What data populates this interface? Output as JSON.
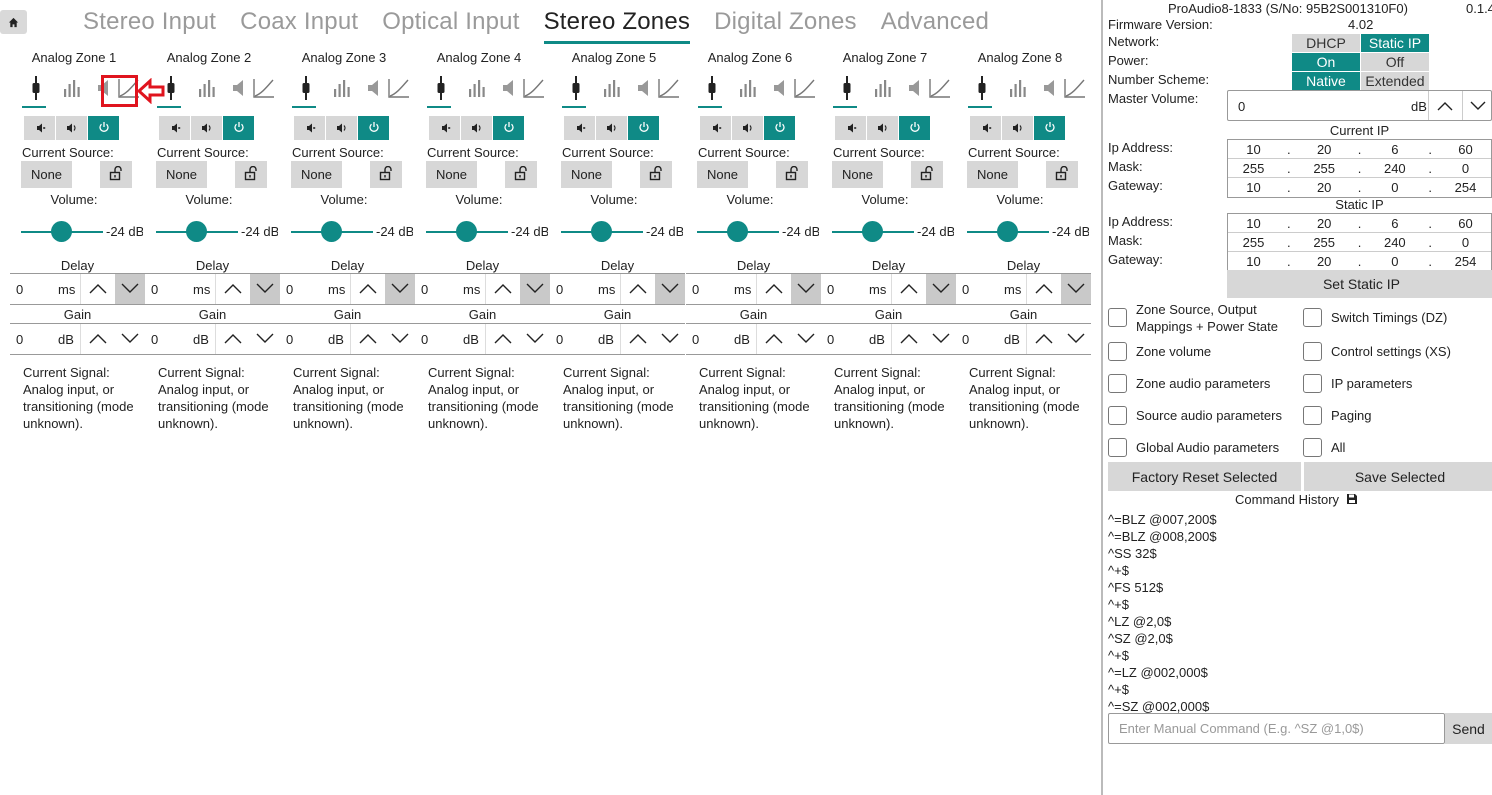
{
  "tabs": [
    "Stereo Input",
    "Coax Input",
    "Optical Input",
    "Stereo Zones",
    "Digital Zones",
    "Advanced"
  ],
  "active_tab": "Stereo Zones",
  "zone_labels": {
    "current_source": "Current Source:",
    "volume": "Volume:",
    "delay": "Delay",
    "gain": "Gain"
  },
  "zones": [
    {
      "name": "Analog Zone 1",
      "source": "None",
      "volume": "-24 dB",
      "volume_level_db": -24,
      "delay": "0",
      "delay_unit": "ms",
      "gain": "0",
      "gain_unit": "dB",
      "signal": "Current Signal: Analog input, or transitioning (mode unknown)."
    },
    {
      "name": "Analog Zone 2",
      "source": "None",
      "volume": "-24 dB",
      "volume_level_db": -24,
      "delay": "0",
      "delay_unit": "ms",
      "gain": "0",
      "gain_unit": "dB",
      "signal": "Current Signal: Analog input, or transitioning (mode unknown)."
    },
    {
      "name": "Analog Zone 3",
      "source": "None",
      "volume": "-24 dB",
      "volume_level_db": -24,
      "delay": "0",
      "delay_unit": "ms",
      "gain": "0",
      "gain_unit": "dB",
      "signal": "Current Signal: Analog input, or transitioning (mode unknown)."
    },
    {
      "name": "Analog Zone 4",
      "source": "None",
      "volume": "-24 dB",
      "volume_level_db": -24,
      "delay": "0",
      "delay_unit": "ms",
      "gain": "0",
      "gain_unit": "dB",
      "signal": "Current Signal: Analog input, or transitioning (mode unknown)."
    },
    {
      "name": "Analog Zone 5",
      "source": "None",
      "volume": "-24 dB",
      "volume_level_db": -24,
      "delay": "0",
      "delay_unit": "ms",
      "gain": "0",
      "gain_unit": "dB",
      "signal": "Current Signal: Analog input, or transitioning (mode unknown)."
    },
    {
      "name": "Analog Zone 6",
      "source": "None",
      "volume": "-24 dB",
      "volume_level_db": -24,
      "delay": "0",
      "delay_unit": "ms",
      "gain": "0",
      "gain_unit": "dB",
      "signal": "Current Signal: Analog input, or transitioning (mode unknown)."
    },
    {
      "name": "Analog Zone 7",
      "source": "None",
      "volume": "-24 dB",
      "volume_level_db": -24,
      "delay": "0",
      "delay_unit": "ms",
      "gain": "0",
      "gain_unit": "dB",
      "signal": "Current Signal: Analog input, or transitioning (mode unknown)."
    },
    {
      "name": "Analog Zone 8",
      "source": "None",
      "volume": "-24 dB",
      "volume_level_db": -24,
      "delay": "0",
      "delay_unit": "ms",
      "gain": "0",
      "gain_unit": "dB",
      "signal": "Current Signal: Analog input, or transitioning (mode unknown)."
    }
  ],
  "device": {
    "title": "ProAudio8-1833 (S/No: 95B2S001310F0)",
    "version": "0.1.4",
    "firmware_label": "Firmware Version:",
    "firmware": "4.02"
  },
  "settings": {
    "network_label": "Network:",
    "network_options": [
      "DHCP",
      "Static IP"
    ],
    "network_selected": "Static IP",
    "power_label": "Power:",
    "power_options": [
      "On",
      "Off"
    ],
    "power_selected": "On",
    "scheme_label": "Number Scheme:",
    "scheme_options": [
      "Native",
      "Extended"
    ],
    "scheme_selected": "Native",
    "master_volume_label": "Master Volume:",
    "master_volume": "0",
    "master_volume_unit": "dB"
  },
  "current_ip": {
    "title": "Current IP",
    "rows": [
      {
        "label": "Ip Address:",
        "octets": [
          "10",
          "20",
          "6",
          "60"
        ]
      },
      {
        "label": "Mask:",
        "octets": [
          "255",
          "255",
          "240",
          "0"
        ]
      },
      {
        "label": "Gateway:",
        "octets": [
          "10",
          "20",
          "0",
          "254"
        ]
      }
    ]
  },
  "static_ip": {
    "title": "Static IP",
    "rows": [
      {
        "label": "Ip Address:",
        "octets": [
          "10",
          "20",
          "6",
          "60"
        ]
      },
      {
        "label": "Mask:",
        "octets": [
          "255",
          "255",
          "240",
          "0"
        ]
      },
      {
        "label": "Gateway:",
        "octets": [
          "10",
          "20",
          "0",
          "254"
        ]
      }
    ],
    "set_button": "Set Static IP"
  },
  "checkboxes": [
    "Zone Source, Output Mappings + Power State",
    "Switch Timings (DZ)",
    "Zone volume",
    "Control settings (XS)",
    "Zone audio parameters",
    "IP parameters",
    "Source audio parameters",
    "Paging",
    "Global Audio parameters",
    "All"
  ],
  "buttons": {
    "factory_reset": "Factory Reset Selected",
    "save": "Save Selected"
  },
  "command_history": {
    "title": "Command History",
    "lines": [
      "^=BLZ @007,200$",
      "^=BLZ @008,200$",
      "^SS 32$",
      "^+$",
      "^FS 512$",
      "^+$",
      "^LZ @2,0$",
      "^SZ @2,0$",
      "^+$",
      "^=LZ @002,000$",
      "^+$",
      "^=SZ @002,000$"
    ],
    "placeholder": "Enter Manual Command (E.g. ^SZ @1,0$)",
    "send": "Send"
  },
  "colors": {
    "accent": "#0f8a86",
    "button_gray": "#d7d7d7",
    "highlight": "#e0141e"
  },
  "icons": [
    "home-icon",
    "input-jack-icon",
    "eq-bars-icon",
    "speaker-icon",
    "curve-graph-icon",
    "volume-down-icon",
    "volume-up-icon",
    "power-icon",
    "lock-open-icon",
    "chevron-up-icon",
    "chevron-down-icon",
    "save-disk-icon",
    "arrow-left-icon"
  ]
}
